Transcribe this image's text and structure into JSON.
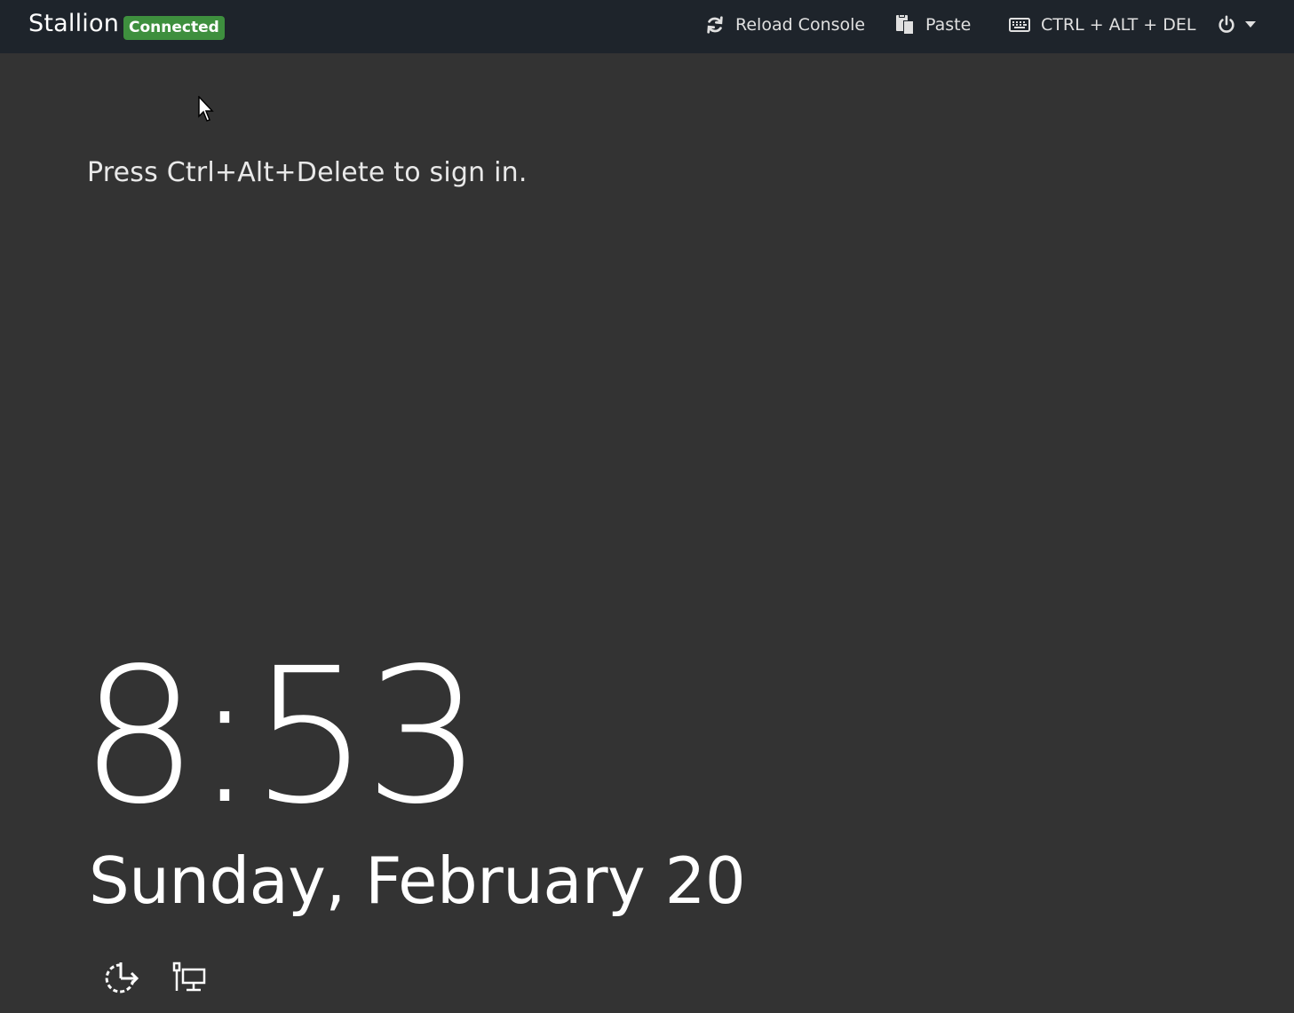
{
  "app": {
    "title": "Stallion",
    "status": "Connected",
    "status_color": "#3e8f3e"
  },
  "toolbar": {
    "reload_label": "Reload Console",
    "reload_icon": "refresh-icon",
    "paste_label": "Paste",
    "paste_icon": "clipboard-icon",
    "cad_label": "CTRL + ALT + DEL",
    "cad_icon": "keyboard-icon",
    "power_icon": "power-icon",
    "power_menu_icon": "caret-down-icon"
  },
  "lockscreen": {
    "prompt": "Press Ctrl+Alt+Delete to sign in.",
    "time": "8:53",
    "date": "Sunday, February 20",
    "icons": [
      "ease-of-access-icon",
      "network-icon"
    ]
  },
  "colors": {
    "topbar": "#1e242b",
    "console_bg": "#333333"
  }
}
